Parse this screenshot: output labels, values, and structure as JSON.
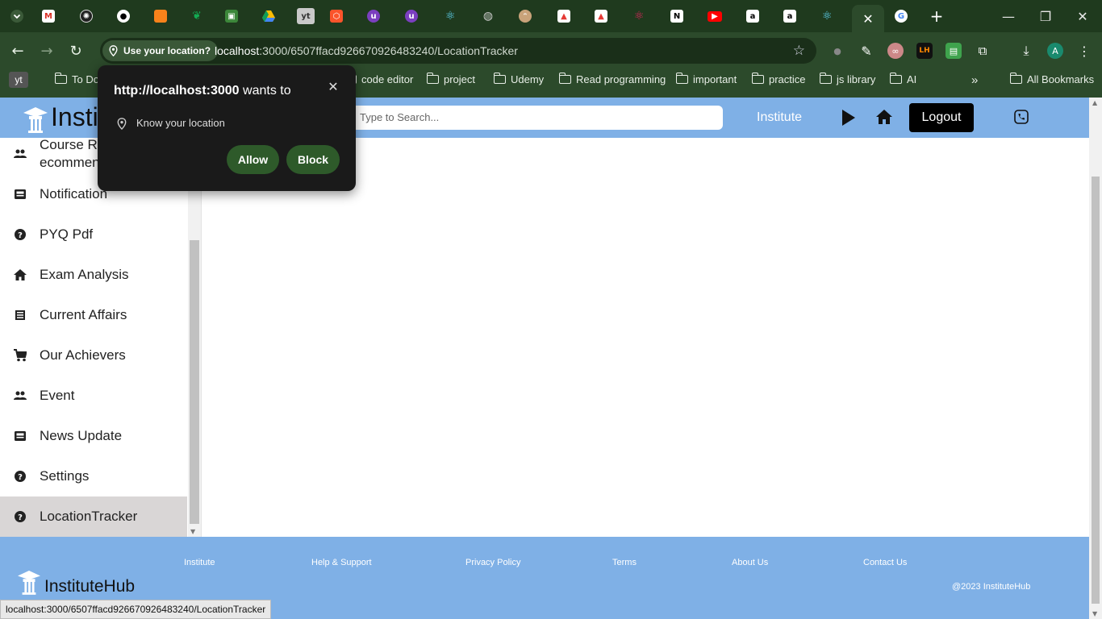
{
  "browser": {
    "tabs": [
      {
        "icon": "chevron-down-icon"
      },
      {
        "icon": "gmail-icon"
      },
      {
        "icon": "chatgpt-icon"
      },
      {
        "icon": "github-icon"
      },
      {
        "icon": "orange-box-icon"
      },
      {
        "icon": "mongodb-icon"
      },
      {
        "icon": "node-icon"
      },
      {
        "icon": "google-drive-icon"
      },
      {
        "icon": "youtube-text-icon",
        "label": "yt"
      },
      {
        "icon": "brave-icon"
      },
      {
        "icon": "ublock-icon"
      },
      {
        "icon": "ublock-icon"
      },
      {
        "icon": "react-icon"
      },
      {
        "icon": "globe-icon"
      },
      {
        "icon": "cat-icon"
      },
      {
        "icon": "triangle-icon"
      },
      {
        "icon": "triangle-icon"
      },
      {
        "icon": "react-icon"
      },
      {
        "icon": "notion-icon"
      },
      {
        "icon": "youtube-icon"
      },
      {
        "icon": "amazon-icon"
      },
      {
        "icon": "amazon-icon"
      },
      {
        "icon": "react-icon"
      }
    ],
    "new_tab_label": "+",
    "omnibox": {
      "location_chip": "Use your location?",
      "url_host": "localhost",
      "url_rest": ":3000/6507ffacd926670926483240/LocationTracker"
    },
    "bookmarks": {
      "yt": "yt",
      "items": [
        "To Do",
        "code editor",
        "project",
        "Udemy",
        "Read programming",
        "important",
        "practice",
        "js library",
        "AI"
      ],
      "overflow": "»",
      "all": "All Bookmarks"
    },
    "profile_initial": "A",
    "status_url": "localhost:3000/6507ffacd926670926483240/LocationTracker"
  },
  "permission_popup": {
    "origin": "http://localhost:3000",
    "title_suffix": " wants to",
    "request": "Know your location",
    "allow": "Allow",
    "block": "Block",
    "close": "✕"
  },
  "header": {
    "brand": "InstituteHub",
    "search_placeholder": "Type to Search...",
    "nav_institute": "Institute",
    "logout": "Logout"
  },
  "sidebar": {
    "items": [
      {
        "label": "Course Recommendation",
        "icon": "people-icon"
      },
      {
        "label": "Notification",
        "icon": "inbox-icon"
      },
      {
        "label": "PYQ Pdf",
        "icon": "help-icon"
      },
      {
        "label": "Exam Analysis",
        "icon": "home-icon"
      },
      {
        "label": "Current Affairs",
        "icon": "list-icon"
      },
      {
        "label": "Our Achievers",
        "icon": "cart-icon"
      },
      {
        "label": "Event",
        "icon": "people-icon"
      },
      {
        "label": "News Update",
        "icon": "inbox-icon"
      },
      {
        "label": "Settings",
        "icon": "help-icon"
      },
      {
        "label": "LocationTracker",
        "icon": "help-icon"
      }
    ],
    "active": "LocationTracker"
  },
  "footer": {
    "links": [
      "Institute",
      "Help & Support",
      "Privacy Policy",
      "Terms",
      "About Us",
      "Contact Us"
    ],
    "brand": "InstituteHub",
    "copyright": "@2023 InstituteHub"
  },
  "colors": {
    "chrome_frame": "#1f3a1e",
    "chrome_toolbar": "#2c4a2b",
    "site_blue": "#7fb0e6",
    "popup_bg": "#1a1a1a",
    "popup_button": "#2e5a2a"
  }
}
